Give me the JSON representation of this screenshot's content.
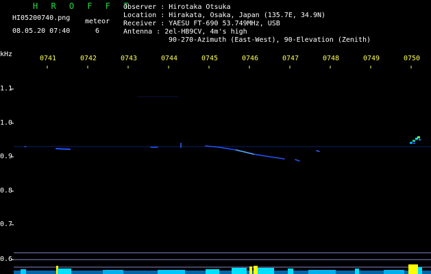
{
  "brand": "H R O F F T",
  "file_name": "HI05200740.png",
  "meteor_label": "meteor",
  "meteor_count": "6",
  "timestamp": "08.05.20 07:40",
  "info": [
    {
      "key": "Observer ",
      "sep": ":",
      "value": "Hirotaka Otsuka"
    },
    {
      "key": "Location ",
      "sep": ":",
      "value": "Hirakata, Osaka, Japan (135.7E, 34.9N)"
    },
    {
      "key": "Receiver ",
      "sep": ":",
      "value": "YAESU FT-690 53.749MHz, USB"
    },
    {
      "key": "Antenna  ",
      "sep": ":",
      "value": "2el-HB9CV, 4m's high"
    },
    {
      "key": "",
      "sep": "",
      "value": "90-270-Azimuth (East-West), 90-Elevation (Zenith)"
    }
  ],
  "y_unit": "kHz",
  "time_ticks": [
    "0741",
    "0742",
    "0743",
    "0744",
    "0745",
    "0746",
    "0747",
    "0748",
    "0749",
    "0750"
  ],
  "freq_ticks": [
    "1.1",
    "1.0",
    "0.9",
    "0.8",
    "0.7",
    "0.6"
  ],
  "colors": {
    "brand": "#22dd44",
    "time_tick": "#ffff55",
    "signal": "#2255ff",
    "signal_bright": "#55aaff",
    "guide_line": "#8888cc",
    "level_bar": "#00e0ff",
    "level_peak": "#ffff00"
  }
}
